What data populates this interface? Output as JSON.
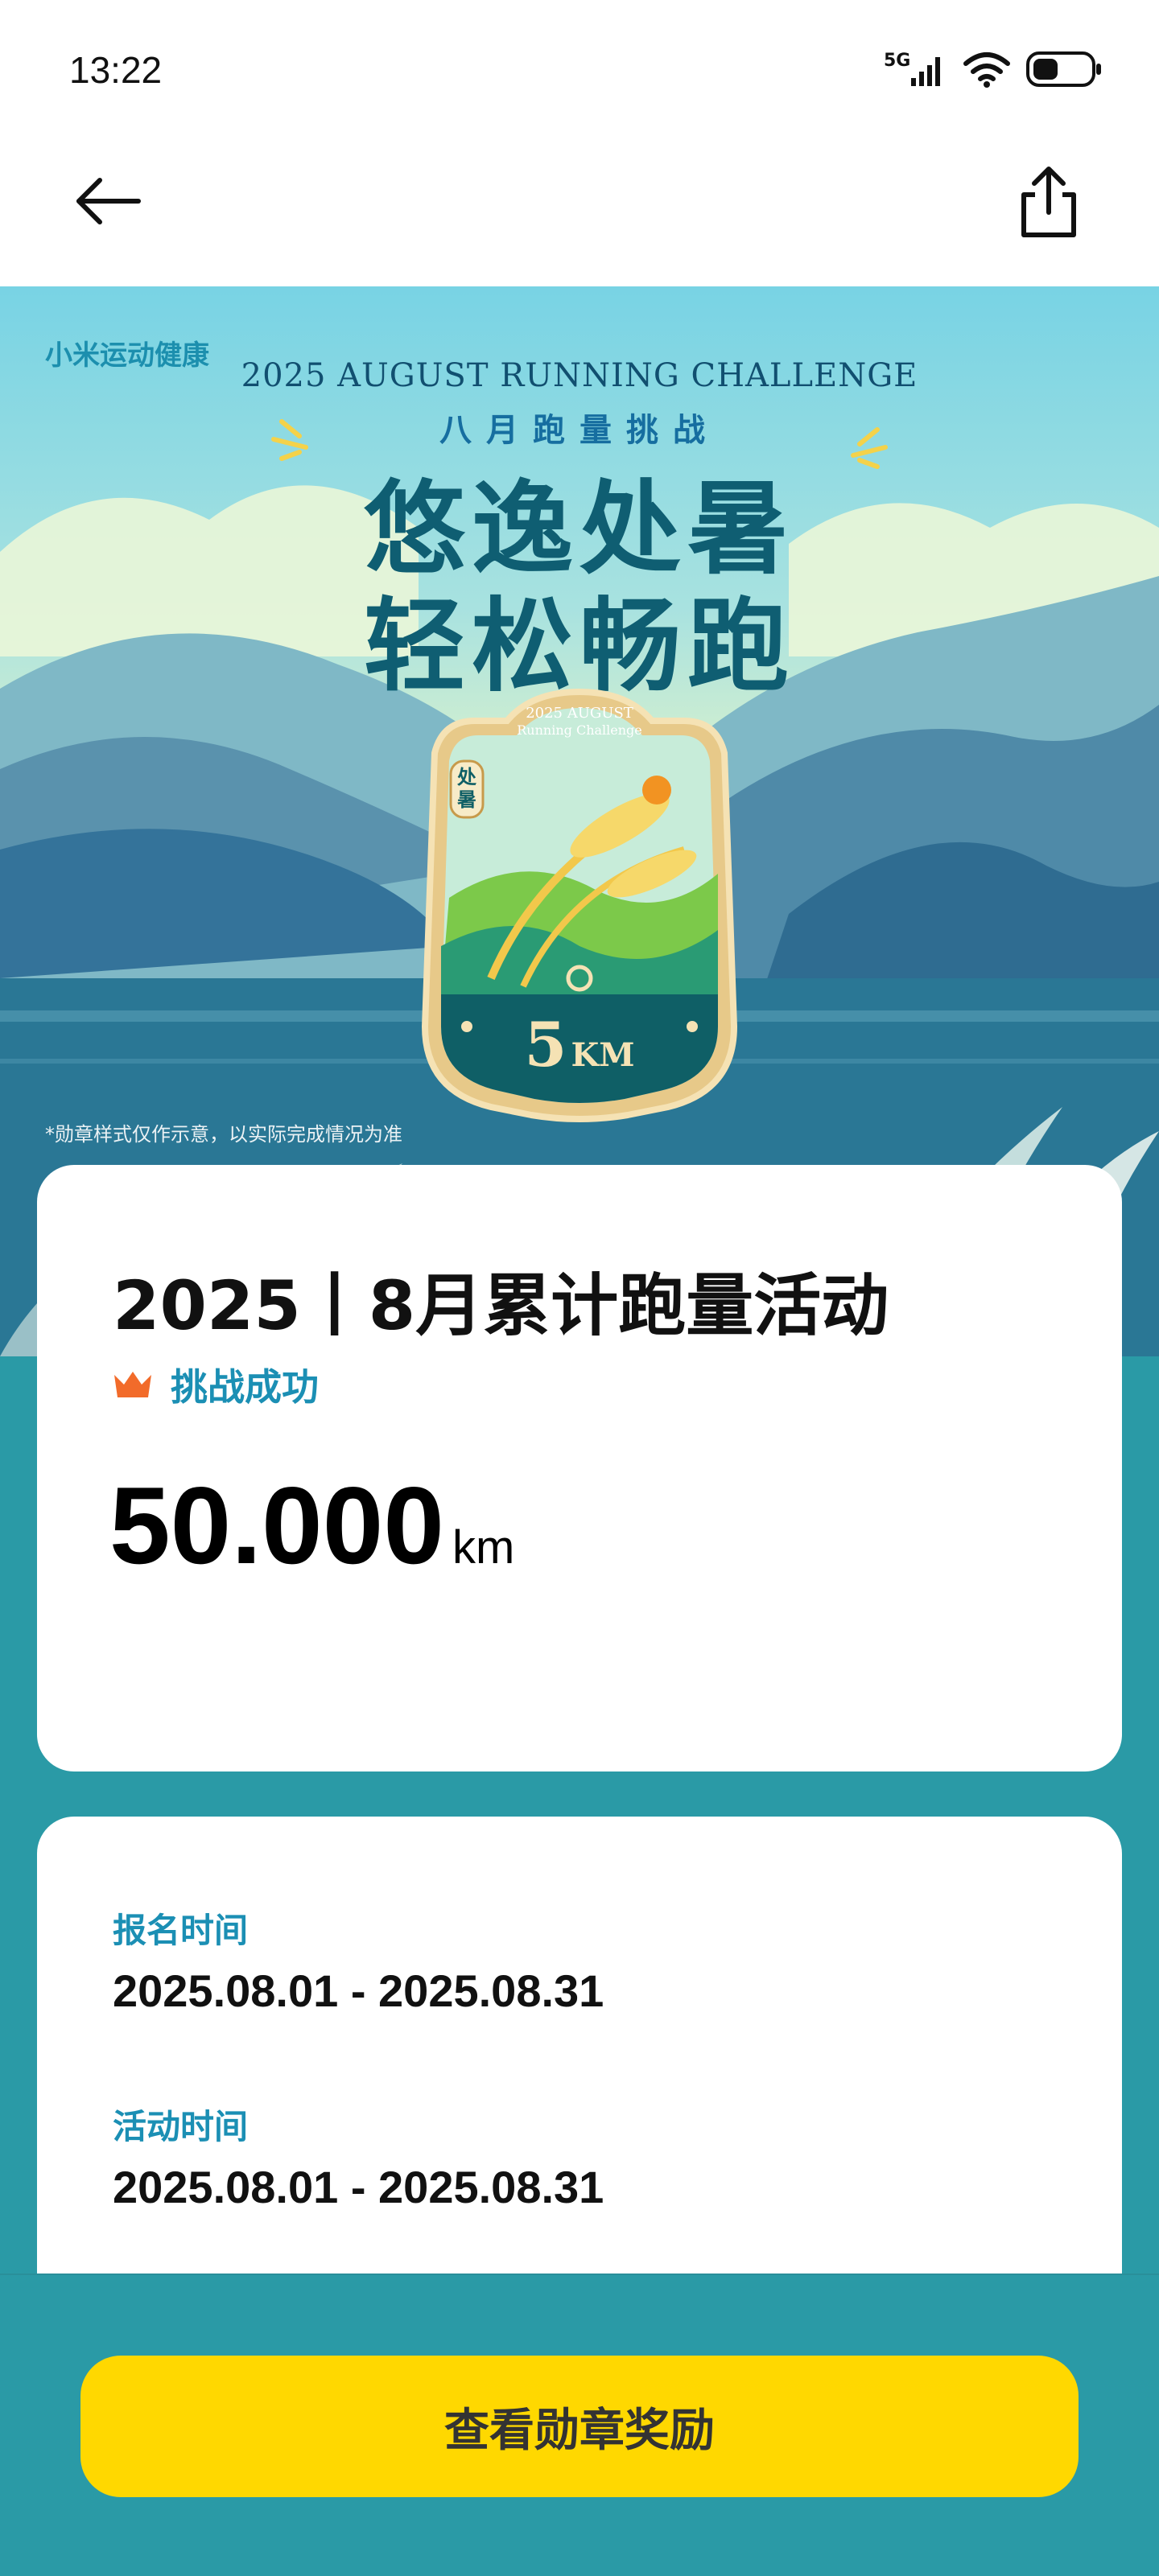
{
  "status_bar": {
    "time": "13:22",
    "network": "5G"
  },
  "hero": {
    "brand": "小米运动健康",
    "en_title": "2025 AUGUST RUNNING CHALLENGE",
    "cn_subtitle": "八月跑量挑战",
    "title_line1": "悠逸处暑",
    "title_line2": "轻松畅跑",
    "medal": {
      "top_text": "2025 AUGUST",
      "top_text2": "Running Challenge",
      "tag": "处暑",
      "distance_num": "5",
      "distance_unit": "KM"
    },
    "disclaimer": "*勋章样式仅作示意，以实际完成情况为准"
  },
  "activity": {
    "title": "2025丨8月累计跑量活动",
    "status": "挑战成功",
    "distance_value": "50.000",
    "distance_unit": "km"
  },
  "info": {
    "signup_label": "报名时间",
    "signup_value": "2025.08.01 - 2025.08.31",
    "activity_label": "活动时间",
    "activity_value": "2025.08.01 - 2025.08.31"
  },
  "cta": {
    "label": "查看勋章奖励"
  },
  "colors": {
    "accent": "#1b8fb4",
    "cta": "#ffd800",
    "crown": "#f26b2a",
    "background": "#2a9aa6"
  }
}
